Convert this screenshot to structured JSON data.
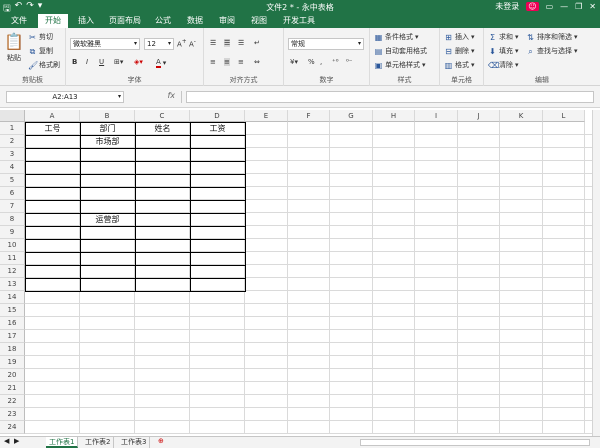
{
  "window": {
    "title": "文件2 * - 永中表格",
    "user": "未登录",
    "qat_icons": [
      "save-icon",
      "undo-icon",
      "redo-icon"
    ],
    "controls": [
      "minimize",
      "restore",
      "close"
    ]
  },
  "menu": {
    "tabs": [
      "文件",
      "开始",
      "插入",
      "页面布局",
      "公式",
      "数据",
      "审阅",
      "视图",
      "开发工具"
    ],
    "active": 1
  },
  "ribbon": {
    "clipboard": {
      "name": "剪贴板",
      "paste": "粘贴",
      "cut": "剪切",
      "copy": "复制",
      "format_painter": "格式刷"
    },
    "font": {
      "name": "字体",
      "family": "微软雅黑",
      "size": "12",
      "bold": "B",
      "italic": "I",
      "underline": "U"
    },
    "alignment": {
      "name": "对齐方式"
    },
    "number": {
      "name": "数字",
      "format": "常规",
      "percent": "%"
    },
    "styles": {
      "name": "样式",
      "conditional": "条件格式",
      "table_format": "自动套用格式",
      "cell_style": "单元格样式"
    },
    "cells": {
      "name": "单元格",
      "insert": "插入",
      "delete": "删除",
      "format": "格式"
    },
    "editing": {
      "name": "编辑",
      "sum": "求和",
      "sort_filter": "排序和筛选",
      "fill": "填充",
      "find_select": "查找与选择",
      "clear": "清除"
    }
  },
  "formula_bar": {
    "name_box": "A2:A13",
    "fx": "fx",
    "content": ""
  },
  "sheet": {
    "columns": [
      "A",
      "B",
      "C",
      "D",
      "E",
      "F",
      "G",
      "H",
      "I",
      "J",
      "K",
      "L"
    ],
    "rows": [
      "1",
      "2",
      "3",
      "4",
      "5",
      "6",
      "7",
      "8",
      "9",
      "10",
      "11",
      "12",
      "13",
      "14",
      "15",
      "16",
      "17",
      "18",
      "19",
      "20",
      "21",
      "22",
      "23",
      "24"
    ],
    "cells": [
      {
        "row": 1,
        "col": 0,
        "text": "工号"
      },
      {
        "row": 1,
        "col": 1,
        "text": "部门"
      },
      {
        "row": 1,
        "col": 2,
        "text": "姓名"
      },
      {
        "row": 1,
        "col": 3,
        "text": "工资"
      },
      {
        "row": 2,
        "col": 1,
        "text": "市场部"
      },
      {
        "row": 8,
        "col": 1,
        "text": "运营部"
      }
    ]
  },
  "sheet_tabs": [
    "工作表1",
    "工作表2",
    "工作表3"
  ],
  "active_sheet": 0
}
